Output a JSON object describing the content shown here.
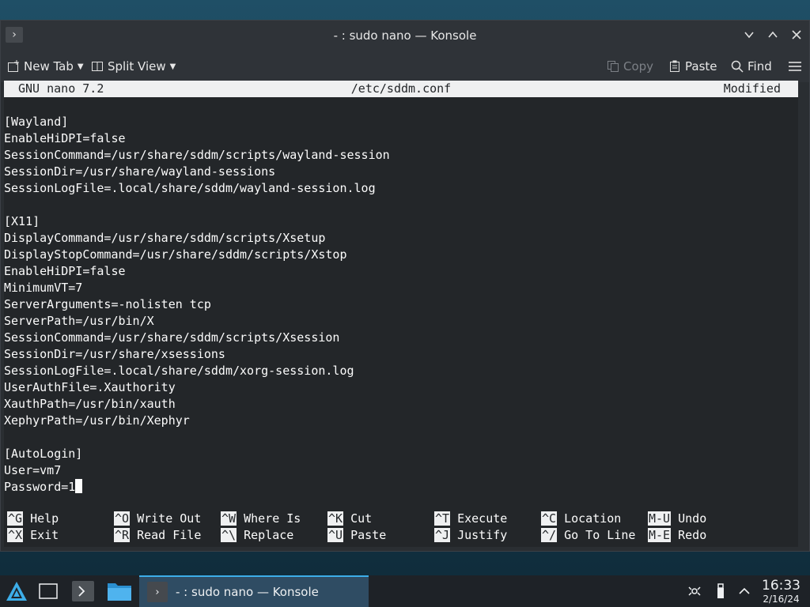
{
  "window": {
    "title": "- : sudo nano — Konsole",
    "app_icon": "terminal-icon",
    "buttons": {
      "minimize": "∨",
      "maximize": "∧",
      "close": "✕"
    }
  },
  "toolbar": {
    "new_tab": "New Tab",
    "split_view": "Split View",
    "copy": "Copy",
    "paste": "Paste",
    "find": "Find"
  },
  "nano": {
    "version": "GNU nano 7.2",
    "file": "/etc/sddm.conf",
    "status": "Modified",
    "lines": [
      "[Wayland]",
      "EnableHiDPI=false",
      "SessionCommand=/usr/share/sddm/scripts/wayland-session",
      "SessionDir=/usr/share/wayland-sessions",
      "SessionLogFile=.local/share/sddm/wayland-session.log",
      "",
      "[X11]",
      "DisplayCommand=/usr/share/sddm/scripts/Xsetup",
      "DisplayStopCommand=/usr/share/sddm/scripts/Xstop",
      "EnableHiDPI=false",
      "MinimumVT=7",
      "ServerArguments=-nolisten tcp",
      "ServerPath=/usr/bin/X",
      "SessionCommand=/usr/share/sddm/scripts/Xsession",
      "SessionDir=/usr/share/xsessions",
      "SessionLogFile=.local/share/sddm/xorg-session.log",
      "UserAuthFile=.Xauthority",
      "XauthPath=/usr/bin/xauth",
      "XephyrPath=/usr/bin/Xephyr",
      "",
      "[AutoLogin]",
      "User=vm7",
      "Password=1"
    ],
    "shortcuts_row1": [
      {
        "key": "^G",
        "label": "Help"
      },
      {
        "key": "^O",
        "label": "Write Out"
      },
      {
        "key": "^W",
        "label": "Where Is"
      },
      {
        "key": "^K",
        "label": "Cut"
      },
      {
        "key": "^T",
        "label": "Execute"
      },
      {
        "key": "^C",
        "label": "Location"
      },
      {
        "key": "M-U",
        "label": "Undo"
      }
    ],
    "shortcuts_row2": [
      {
        "key": "^X",
        "label": "Exit"
      },
      {
        "key": "^R",
        "label": "Read File"
      },
      {
        "key": "^\\",
        "label": "Replace"
      },
      {
        "key": "^U",
        "label": "Paste"
      },
      {
        "key": "^J",
        "label": "Justify"
      },
      {
        "key": "^/",
        "label": "Go To Line"
      },
      {
        "key": "M-E",
        "label": "Redo"
      }
    ]
  },
  "taskbar": {
    "task_label": "- : sudo nano — Konsole",
    "clock_time": "16:33",
    "clock_date": "2/16/24",
    "accent": "#3daee9"
  }
}
